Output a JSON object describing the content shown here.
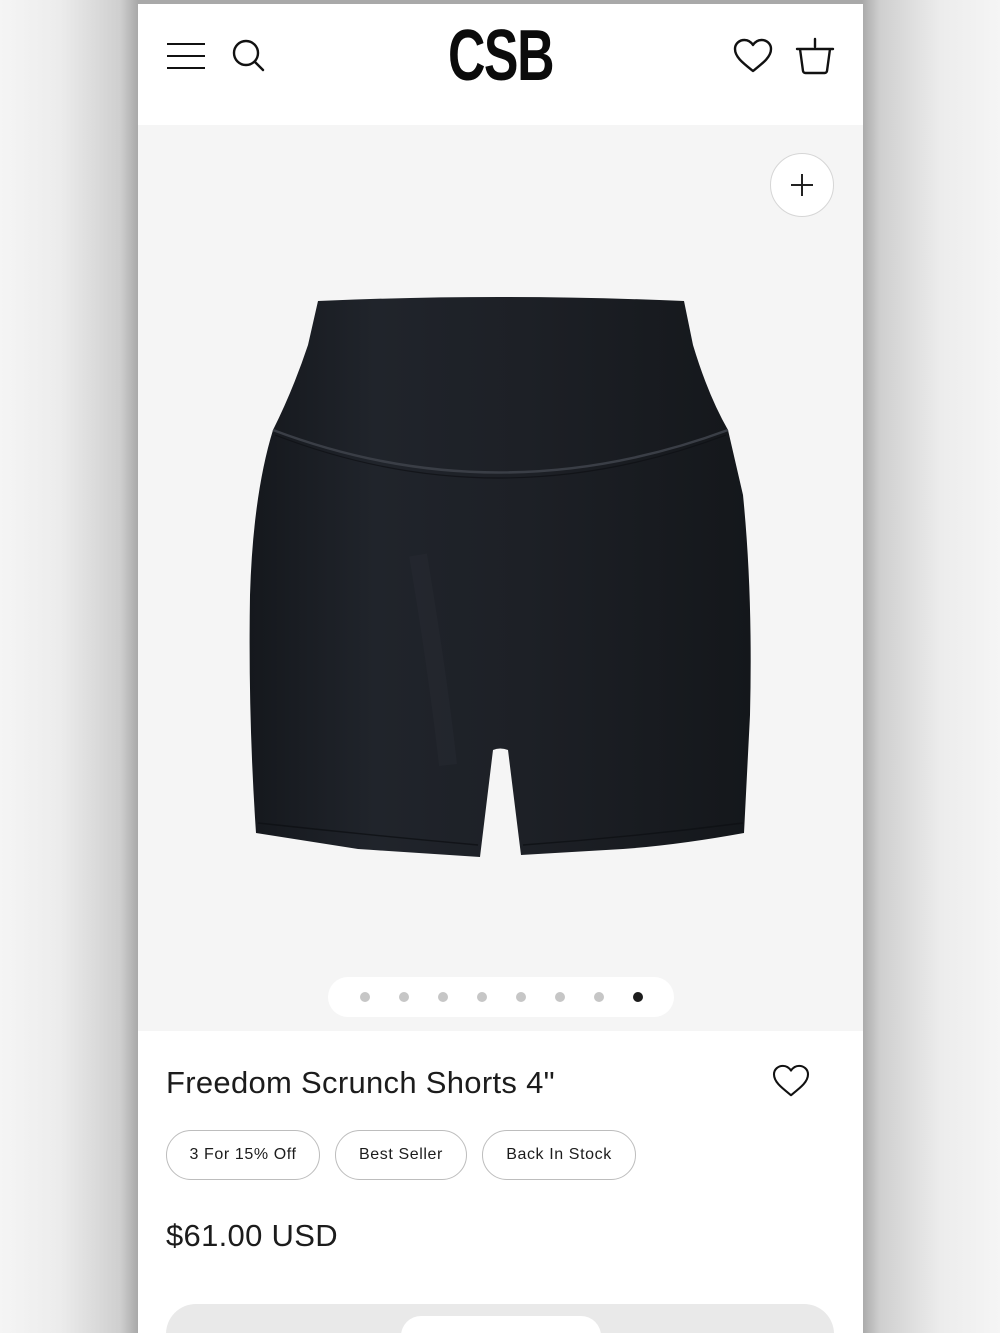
{
  "header": {
    "logo": "CSB",
    "icons": [
      "menu-icon",
      "search-icon",
      "heart-icon",
      "basket-icon"
    ]
  },
  "gallery": {
    "zoom_icon": "plus-icon",
    "slide_count": 8,
    "active_slide": 8
  },
  "product": {
    "title": "Freedom Scrunch Shorts 4\"",
    "tags": [
      "3 For 15% Off",
      "Best Seller",
      "Back In Stock"
    ],
    "price": "$61.00 USD"
  },
  "colors": {
    "page_bg": "#ffffff",
    "gallery_bg": "#f5f5f5",
    "text": "#1c1c1c",
    "product_fill": "#1d2026",
    "dot_active": "#1c1c1c",
    "dot_inactive": "#c6c6c6"
  }
}
